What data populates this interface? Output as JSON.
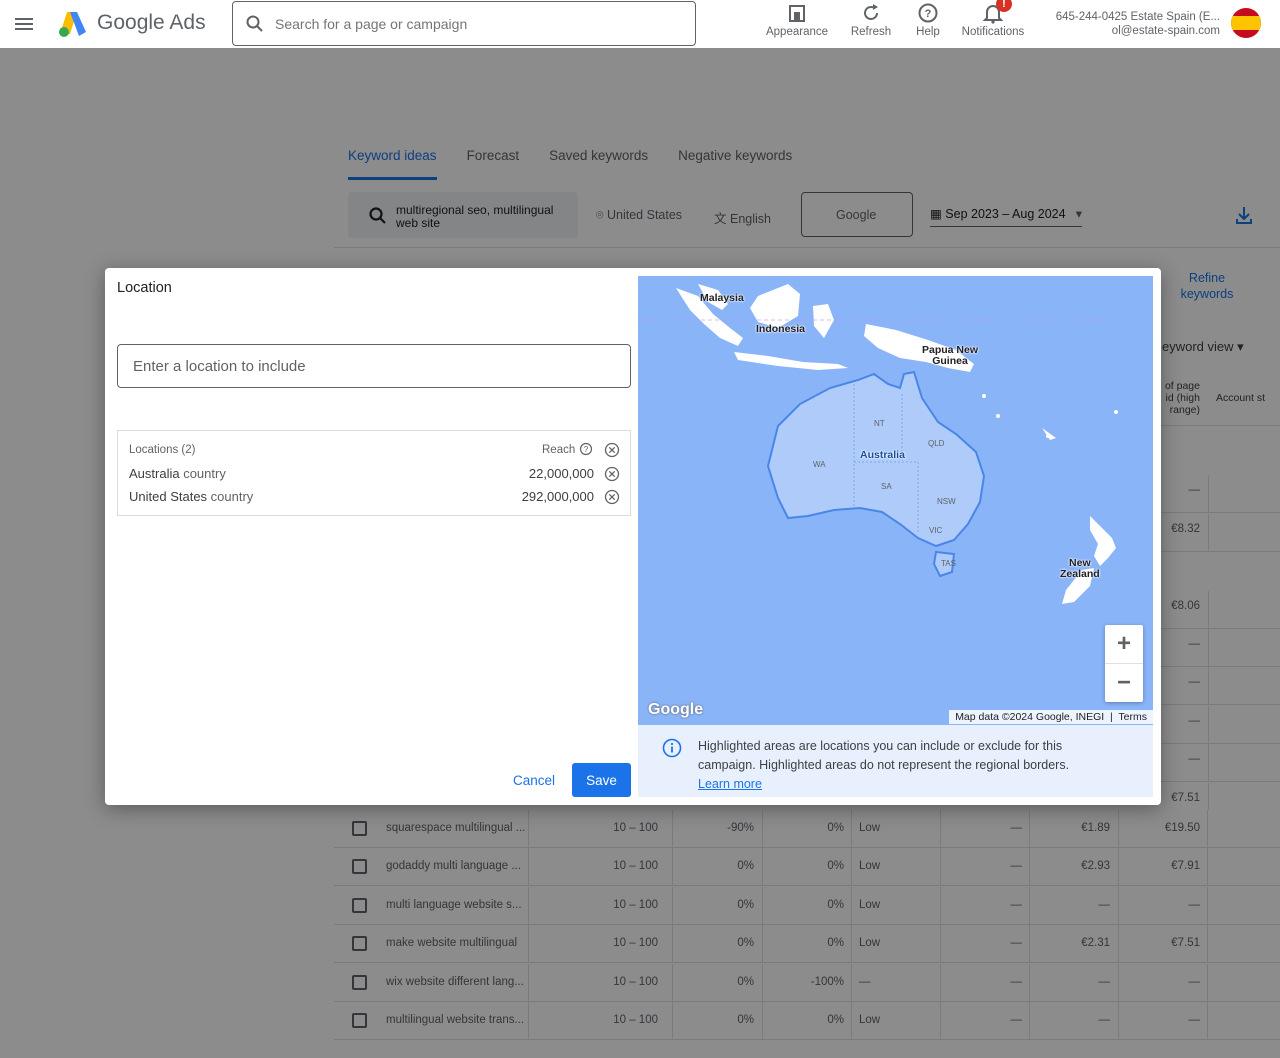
{
  "header": {
    "brand": "Google Ads",
    "search_placeholder": "Search for a page or campaign",
    "tools": [
      {
        "label": "Appearance",
        "icon": "appearance-icon"
      },
      {
        "label": "Refresh",
        "icon": "refresh-icon"
      },
      {
        "label": "Help",
        "icon": "help-icon"
      },
      {
        "label": "Notifications",
        "icon": "bell-icon"
      }
    ],
    "notification_badge": "!",
    "account_line1": "645-244-0425 Estate Spain (E...",
    "account_line2": "ol@estate-spain.com"
  },
  "tabs": [
    "Keyword ideas",
    "Forecast",
    "Saved keywords",
    "Negative keywords"
  ],
  "filters": {
    "keywords": "multiregional seo, multilingual web site",
    "location": "United States",
    "language": "English",
    "network": "Google",
    "date_range": "Sep 2023 – Aug 2024"
  },
  "side": {
    "refine": "Refine keywords",
    "keyword_view": "eyword view",
    "col_a": "of page id (high range)",
    "col_b": "Account st"
  },
  "side_values": [
    "—",
    "€8.32",
    "€8.06",
    "—",
    "—",
    "—",
    "—",
    "€7.51"
  ],
  "rows": [
    {
      "keyword": "squarespace multilingual ...",
      "searches": "10 – 100",
      "three_month": "-90%",
      "yoy": "0%",
      "competition": "Low",
      "impr": "—",
      "low_bid": "€1.89",
      "high_bid": "€19.50"
    },
    {
      "keyword": "godaddy multi language ...",
      "searches": "10 – 100",
      "three_month": "0%",
      "yoy": "0%",
      "competition": "Low",
      "impr": "—",
      "low_bid": "€2.93",
      "high_bid": "€7.91"
    },
    {
      "keyword": "multi language website s...",
      "searches": "10 – 100",
      "three_month": "0%",
      "yoy": "0%",
      "competition": "Low",
      "impr": "—",
      "low_bid": "—",
      "high_bid": "—"
    },
    {
      "keyword": "make website multilingual",
      "searches": "10 – 100",
      "three_month": "0%",
      "yoy": "0%",
      "competition": "Low",
      "impr": "—",
      "low_bid": "€2.31",
      "high_bid": "€7.51"
    },
    {
      "keyword": "wix website different lang...",
      "searches": "10 – 100",
      "three_month": "0%",
      "yoy": "-100%",
      "competition": "—",
      "impr": "—",
      "low_bid": "—",
      "high_bid": "—"
    },
    {
      "keyword": "multilingual website trans...",
      "searches": "10 – 100",
      "three_month": "0%",
      "yoy": "0%",
      "competition": "Low",
      "impr": "—",
      "low_bid": "—",
      "high_bid": "—"
    }
  ],
  "dialog": {
    "title": "Location",
    "input_placeholder": "Enter a location to include",
    "list_header": "Locations (2)",
    "reach_label": "Reach",
    "locations": [
      {
        "name": "Australia",
        "type": "country",
        "reach": "22,000,000"
      },
      {
        "name": "United States",
        "type": "country",
        "reach": "292,000,000"
      }
    ],
    "cancel": "Cancel",
    "save": "Save"
  },
  "map": {
    "labels": {
      "malaysia": "Malaysia",
      "indonesia": "Indonesia",
      "png1": "Papua New",
      "png2": "Guinea",
      "australia": "Australia",
      "nz1": "New",
      "nz2": "Zealand"
    },
    "states": [
      "NT",
      "QLD",
      "WA",
      "SA",
      "NSW",
      "VIC",
      "TAS"
    ],
    "watermark": "Google",
    "attribution": "Map data ©2024 Google, INEGI",
    "terms": "Terms",
    "zoom_in": "+",
    "zoom_out": "−"
  },
  "info": {
    "text": "Highlighted areas are locations you can include or exclude for this campaign. Highlighted areas do not represent the regional borders.",
    "link": "Learn more"
  },
  "colors": {
    "accent": "#1a73e8",
    "map_water": "#8ab4f8",
    "highlight_land": "#aecbfa"
  }
}
